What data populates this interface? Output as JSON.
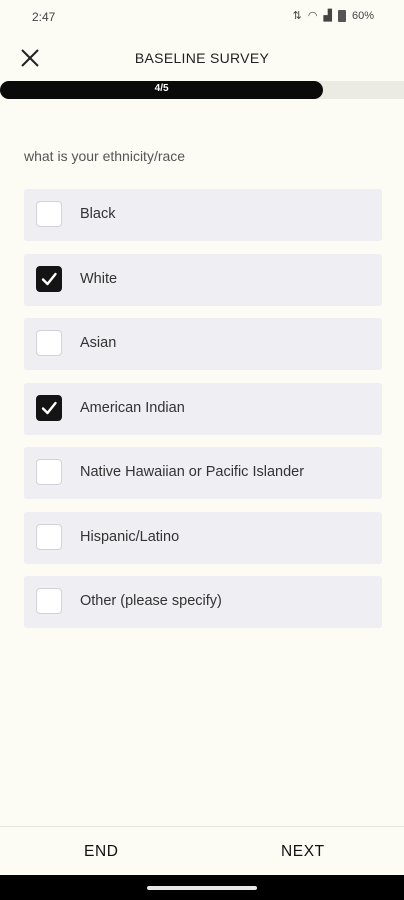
{
  "status_bar": {
    "time": "2:47",
    "battery_text": "60%",
    "icons": [
      "data-icon",
      "wifi-icon",
      "signal-icon",
      "battery-icon"
    ]
  },
  "header": {
    "title": "BASELINE SURVEY",
    "close_icon": "close-icon"
  },
  "progress": {
    "label": "4/5",
    "fraction": 0.8,
    "fill_color": "#0a0a0a"
  },
  "question": {
    "text": "what is your ethnicity/race",
    "options": [
      {
        "label": "Black",
        "checked": false
      },
      {
        "label": "White",
        "checked": true
      },
      {
        "label": "Asian",
        "checked": false
      },
      {
        "label": "American Indian",
        "checked": true
      },
      {
        "label": "Native Hawaiian or Pacific Islander",
        "checked": false
      },
      {
        "label": "Hispanic/Latino",
        "checked": false
      },
      {
        "label": "Other (please specify)",
        "checked": false
      }
    ]
  },
  "footer": {
    "end_label": "END",
    "next_label": "NEXT"
  }
}
